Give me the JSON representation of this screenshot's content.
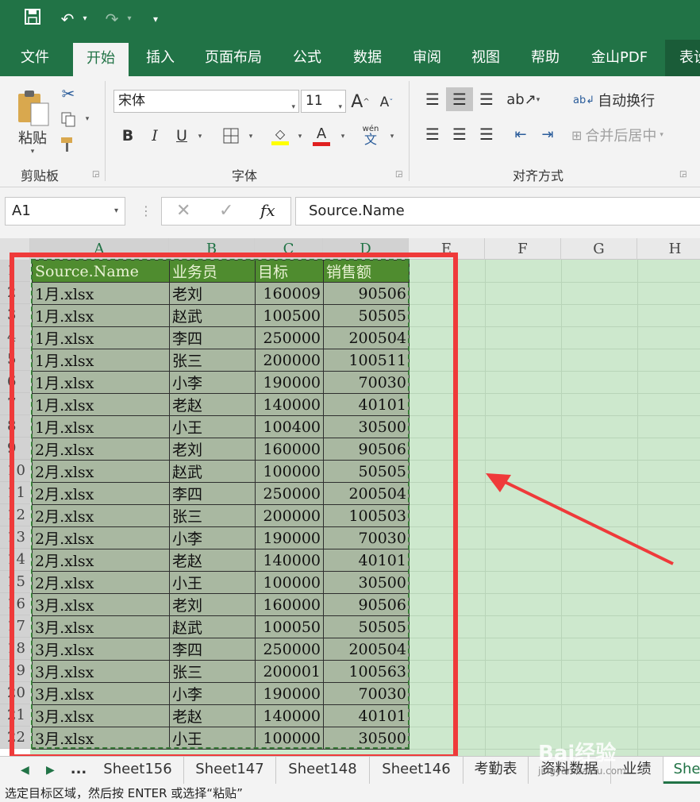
{
  "qat": {
    "undo": "↶",
    "redo": "↷"
  },
  "tabs": [
    "文件",
    "开始",
    "插入",
    "页面布局",
    "公式",
    "数据",
    "审阅",
    "视图",
    "帮助",
    "金山PDF",
    "表设"
  ],
  "active_tab": "开始",
  "ribbon": {
    "clipboard": {
      "paste_label": "粘贴",
      "group_label": "剪贴板"
    },
    "font": {
      "font_name": "宋体",
      "font_size": "11",
      "group_label": "字体",
      "bold": "B",
      "italic": "I",
      "underline": "U",
      "grow": "A",
      "shrink": "A",
      "phonetic": "wén",
      "phonetic_char": "文"
    },
    "alignment": {
      "wrap_text": "自动换行",
      "merge_center": "合并后居中",
      "group_label": "对齐方式"
    }
  },
  "formula_bar": {
    "name_box": "A1",
    "fx": "fx",
    "content": "Source.Name"
  },
  "columns": [
    "A",
    "B",
    "C",
    "D",
    "E",
    "F",
    "G",
    "H"
  ],
  "row_numbers": [
    "1",
    "2",
    "3",
    "4",
    "5",
    "6",
    "7",
    "8",
    "9",
    "10",
    "11",
    "12",
    "13",
    "14",
    "15",
    "16",
    "17",
    "18",
    "19",
    "20",
    "21",
    "22"
  ],
  "table": {
    "header": [
      "Source.Name",
      "业务员",
      "目标",
      "销售额"
    ],
    "rows": [
      [
        "1月.xlsx",
        "老刘",
        "160009",
        "90506"
      ],
      [
        "1月.xlsx",
        "赵武",
        "100500",
        "50505"
      ],
      [
        "1月.xlsx",
        "李四",
        "250000",
        "200504"
      ],
      [
        "1月.xlsx",
        "张三",
        "200000",
        "100511"
      ],
      [
        "1月.xlsx",
        "小李",
        "190000",
        "70030"
      ],
      [
        "1月.xlsx",
        "老赵",
        "140000",
        "40101"
      ],
      [
        "1月.xlsx",
        "小王",
        "100400",
        "30500"
      ],
      [
        "2月.xlsx",
        "老刘",
        "160000",
        "90506"
      ],
      [
        "2月.xlsx",
        "赵武",
        "100000",
        "50505"
      ],
      [
        "2月.xlsx",
        "李四",
        "250000",
        "200504"
      ],
      [
        "2月.xlsx",
        "张三",
        "200000",
        "100503"
      ],
      [
        "2月.xlsx",
        "小李",
        "190000",
        "70030"
      ],
      [
        "2月.xlsx",
        "老赵",
        "140000",
        "40101"
      ],
      [
        "2月.xlsx",
        "小王",
        "100000",
        "30500"
      ],
      [
        "3月.xlsx",
        "老刘",
        "160000",
        "90506"
      ],
      [
        "3月.xlsx",
        "赵武",
        "100050",
        "50505"
      ],
      [
        "3月.xlsx",
        "李四",
        "250000",
        "200504"
      ],
      [
        "3月.xlsx",
        "张三",
        "200001",
        "100563"
      ],
      [
        "3月.xlsx",
        "小李",
        "190000",
        "70030"
      ],
      [
        "3月.xlsx",
        "老赵",
        "140000",
        "40101"
      ],
      [
        "3月.xlsx",
        "小王",
        "100000",
        "30500"
      ]
    ]
  },
  "sheet_tabs": [
    "...",
    "Sheet156",
    "Sheet147",
    "Sheet148",
    "Sheet146",
    "考勤表",
    "资料数据",
    "业绩",
    "She"
  ],
  "active_sheet": "She",
  "status_bar": "选定目标区域，然后按 ENTER 或选择“粘贴”",
  "watermark": {
    "text": "Bai经验",
    "sub": "jingyan.baidu.com"
  },
  "colors": {
    "excel_green": "#217346",
    "header_fill": "#4f8c2f",
    "data_fill": "#a9b8a1",
    "selection_fill": "#cde8cd",
    "annotation_red": "#ef3a3a"
  }
}
